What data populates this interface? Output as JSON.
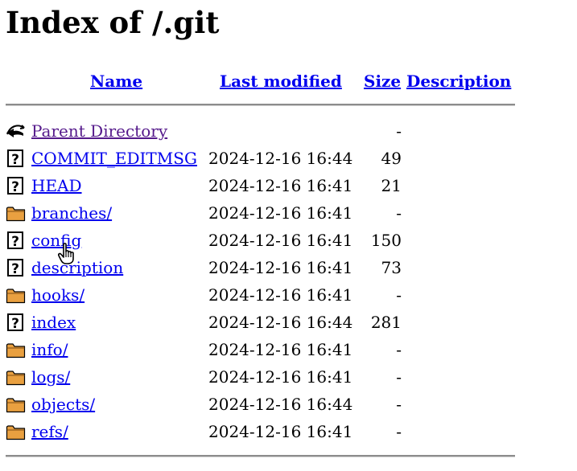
{
  "page": {
    "title": "Index of /.git"
  },
  "table": {
    "columns": {
      "name": "Name",
      "last_modified": "Last modified",
      "size": "Size",
      "description": "Description"
    },
    "parent": {
      "label": "Parent Directory",
      "date": "",
      "size": "-",
      "icon": "back-icon"
    },
    "rows": [
      {
        "name": "COMMIT_EDITMSG",
        "date": "2024-12-16 16:44",
        "size": "49",
        "icon": "unknown-file-icon"
      },
      {
        "name": "HEAD",
        "date": "2024-12-16 16:41",
        "size": "21",
        "icon": "unknown-file-icon"
      },
      {
        "name": "branches/",
        "date": "2024-12-16 16:41",
        "size": "-",
        "icon": "folder-icon"
      },
      {
        "name": "config",
        "date": "2024-12-16 16:41",
        "size": "150",
        "icon": "unknown-file-icon"
      },
      {
        "name": "description",
        "date": "2024-12-16 16:41",
        "size": "73",
        "icon": "unknown-file-icon"
      },
      {
        "name": "hooks/",
        "date": "2024-12-16 16:41",
        "size": "-",
        "icon": "folder-icon"
      },
      {
        "name": "index",
        "date": "2024-12-16 16:44",
        "size": "281",
        "icon": "unknown-file-icon"
      },
      {
        "name": "info/",
        "date": "2024-12-16 16:41",
        "size": "-",
        "icon": "folder-icon"
      },
      {
        "name": "logs/",
        "date": "2024-12-16 16:41",
        "size": "-",
        "icon": "folder-icon"
      },
      {
        "name": "objects/",
        "date": "2024-12-16 16:44",
        "size": "-",
        "icon": "folder-icon"
      },
      {
        "name": "refs/",
        "date": "2024-12-16 16:41",
        "size": "-",
        "icon": "folder-icon"
      }
    ]
  },
  "colors": {
    "link": "#0000ee",
    "visited": "#551a8b",
    "rule": "#8c8c8c",
    "folder": "#e9a040"
  }
}
